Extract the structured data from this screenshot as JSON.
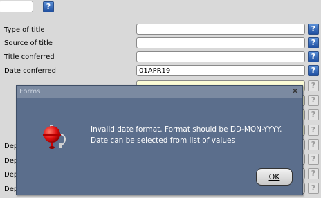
{
  "form": {
    "fields": [
      {
        "label": "Type of title",
        "value": ""
      },
      {
        "label": "Source of title",
        "value": ""
      },
      {
        "label": "Title conferred",
        "value": ""
      },
      {
        "label": "Date conferred",
        "value": "01APR19"
      }
    ],
    "partial_labels": [
      "Dep",
      "Dep",
      "Dep",
      "Dep"
    ],
    "lov_glyph": "?"
  },
  "dialog": {
    "title": "Forms",
    "close_glyph": "✕",
    "message_line1": "Invalid date format. Format should be DD-MON-YYYY.",
    "message_line2": "Date can be selected from list of values",
    "ok_label": "OK",
    "icon": "alarm-bell-icon"
  },
  "colors": {
    "background": "#d9d9d9",
    "dialog_bg": "#5b6e8c",
    "help_button": "#1f4fa0",
    "yellow_field": "#fbfbd6"
  }
}
